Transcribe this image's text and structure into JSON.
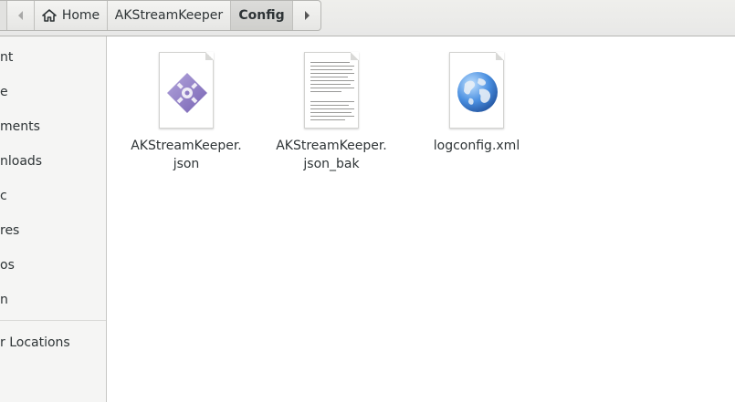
{
  "pathbar": {
    "home_label": "Home",
    "crumbs": [
      "AKStreamKeeper",
      "Config"
    ],
    "icons": {
      "back": "chevron-left-icon",
      "home": "home-icon",
      "forward": "chevron-right-icon"
    }
  },
  "sidebar": {
    "items": [
      "nt",
      "e",
      "ments",
      "nloads",
      "c",
      "res",
      "os",
      "n",
      "r Locations"
    ]
  },
  "files": [
    {
      "name_line1": "AKStreamKeeper.",
      "name_line2": "json",
      "icon": "json-file-icon"
    },
    {
      "name_line1": "AKStreamKeeper.",
      "name_line2": "json_bak",
      "icon": "text-file-icon"
    },
    {
      "name_line1": "logconfig.xml",
      "name_line2": "",
      "icon": "xml-globe-file-icon"
    }
  ],
  "colors": {
    "json_icon": "#8e7cc3",
    "globe": "#3b7dd8"
  }
}
